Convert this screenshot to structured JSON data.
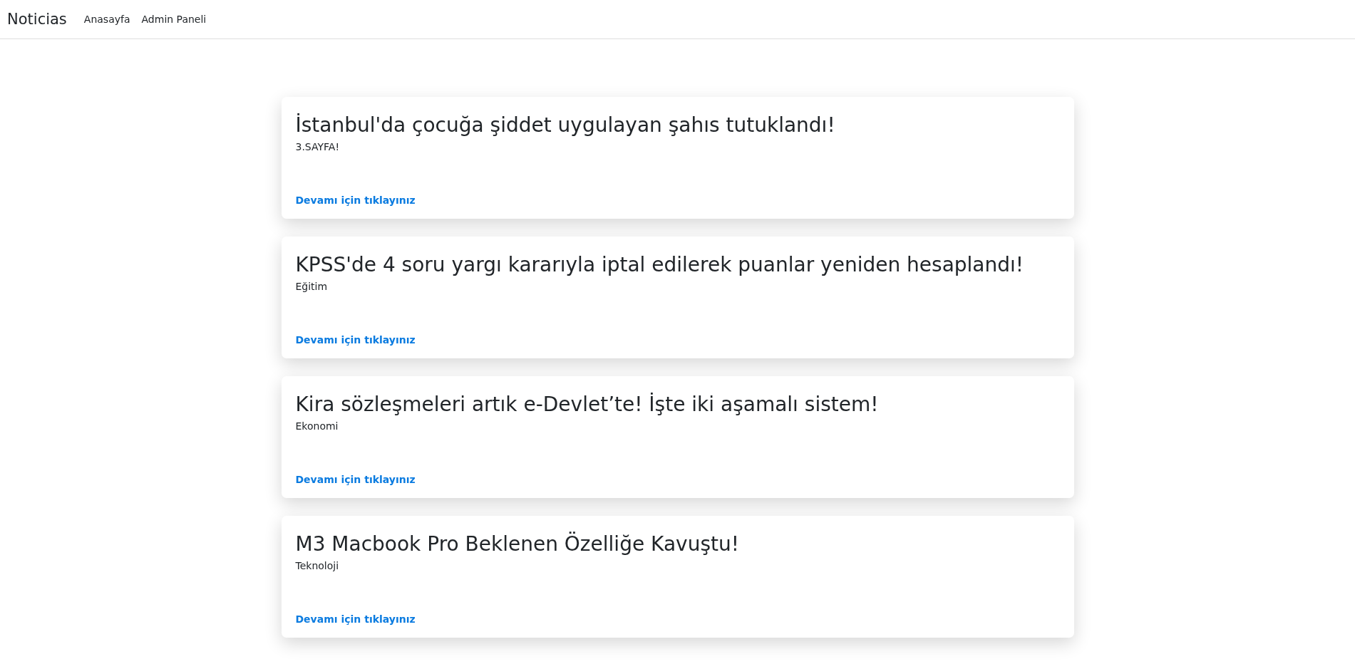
{
  "navbar": {
    "brand": "Noticias",
    "links": [
      "Anasayfa",
      "Admin Paneli"
    ]
  },
  "articles": [
    {
      "title": "İstanbul'da çocuğa şiddet uygulayan şahıs tutuklandı!",
      "category": "3.SAYFA!",
      "link": "Devamı için tıklayınız"
    },
    {
      "title": "KPSS'de 4 soru yargı kararıyla iptal edilerek puanlar yeniden hesaplandı!",
      "category": "Eğitim",
      "link": "Devamı için tıklayınız"
    },
    {
      "title": "Kira sözleşmeleri artık e-Devlet’te! İşte iki aşamalı sistem!",
      "category": "Ekonomi",
      "link": "Devamı için tıklayınız"
    },
    {
      "title": "M3 Macbook Pro Beklenen Özelliğe Kavuştu!",
      "category": "Teknoloji",
      "link": "Devamı için tıklayınız"
    }
  ]
}
